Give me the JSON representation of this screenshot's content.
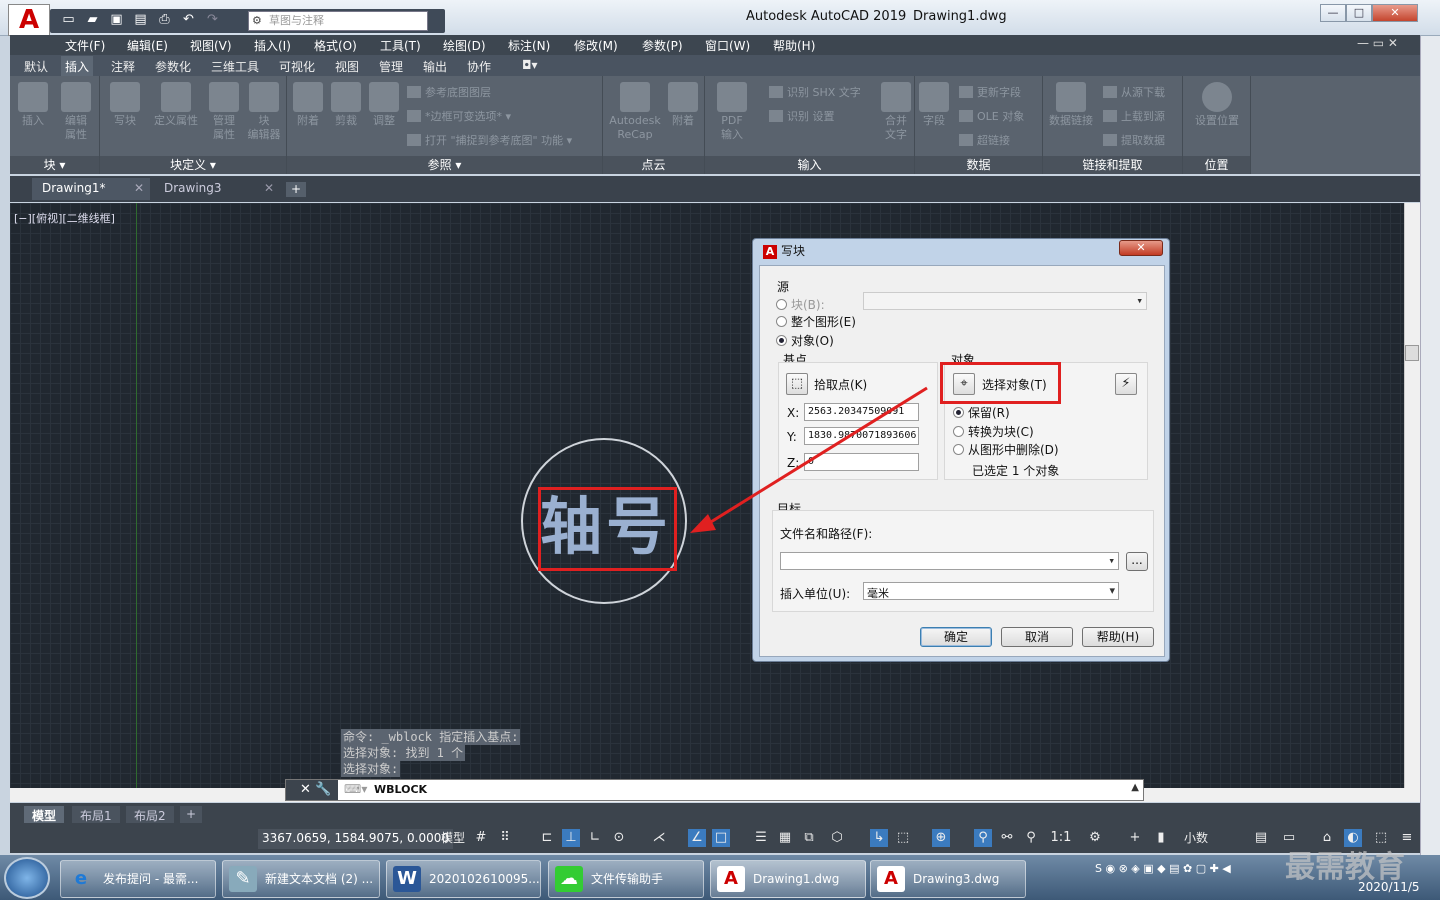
{
  "window": {
    "app_title": "Autodesk AutoCAD 2019",
    "doc_title": "Drawing1.dwg",
    "controls": [
      "—",
      "□",
      "✕"
    ]
  },
  "qat": {
    "workspace": "草图与注释"
  },
  "menubar": {
    "items": [
      "文件(F)",
      "编辑(E)",
      "视图(V)",
      "插入(I)",
      "格式(O)",
      "工具(T)",
      "绘图(D)",
      "标注(N)",
      "修改(M)",
      "参数(P)",
      "窗口(W)",
      "帮助(H)"
    ]
  },
  "ribbon_tabs": {
    "items": [
      "默认",
      "插入",
      "注释",
      "参数化",
      "三维工具",
      "可视化",
      "视图",
      "管理",
      "输出",
      "协作"
    ],
    "active": "插入"
  },
  "ribbon": {
    "panels": [
      "块 ▾",
      "块定义 ▾",
      "参照 ▾",
      "点云",
      "输入",
      "数据",
      "链接和提取",
      "位置"
    ],
    "block": [
      "插入",
      "编辑\n属性"
    ],
    "blockdef": [
      "写块",
      "定义属性",
      "管理\n属性",
      "块\n编辑器"
    ],
    "ref": [
      "附着",
      "剪裁",
      "调整"
    ],
    "ref_small": [
      "参考底图图层",
      "*边框可变选项*",
      "打开 \"捕捉到参考底图\" 功能"
    ],
    "pointcloud": [
      "Autodesk\nReCap",
      "附着"
    ],
    "import": [
      "PDF\n输入"
    ],
    "import_small": [
      "识别 SHX 文字",
      "识别 设置"
    ],
    "data": [
      "合并\n文字",
      "字段"
    ],
    "data_small": [
      "更新字段",
      "OLE 对象",
      "超链接"
    ],
    "link": [
      "数据链接"
    ],
    "link_small": [
      "从源下载",
      "上载到源",
      "提取数据"
    ],
    "location": [
      "设置位置"
    ]
  },
  "doc_tabs": {
    "items": [
      "Drawing1*",
      "Drawing3"
    ],
    "plus": "+"
  },
  "viewport": {
    "label": "[−][俯视][二维线框]"
  },
  "drawing": {
    "text": "轴号"
  },
  "command": {
    "history": [
      "命令: _wblock 指定插入基点:",
      "选择对象: 找到 1 个",
      "选择对象:"
    ],
    "input": "WBLOCK"
  },
  "layout_tabs": {
    "items": [
      "模型",
      "布局1",
      "布局2"
    ],
    "plus": "+"
  },
  "status": {
    "coords": "3367.0659, 1584.9075, 0.0000",
    "model": "模型",
    "scale": "1:1",
    "units": "小数"
  },
  "dialog": {
    "title": "写块",
    "source_label": "源",
    "radio_block": "块(B):",
    "radio_whole": "整个图形(E)",
    "radio_objects": "对象(O)",
    "basepoint_label": "基点",
    "pick_point": "拾取点(K)",
    "x_label": "X:",
    "x_value": "2563.20347509091",
    "y_label": "Y:",
    "y_value": "1830.9870071893606",
    "z_label": "Z:",
    "z_value": "0",
    "objects_label": "对象",
    "select_objects": "选择对象(T)",
    "retain": "保留(R)",
    "convert": "转换为块(C)",
    "delete": "从图形中删除(D)",
    "selected_count": "已选定 1 个对象",
    "target_label": "目标",
    "filename_label": "文件名和路径(F):",
    "filename_value": "",
    "browse": "...",
    "units_label": "插入单位(U):",
    "units_value": "毫米",
    "ok": "确定",
    "cancel": "取消",
    "help": "帮助(H)"
  },
  "taskbar": {
    "items": [
      "发布提问 - 最需...",
      "新建文本文档 (2) ...",
      "2020102610095...",
      "文件传输助手",
      "Drawing1.dwg",
      "Drawing3.dwg"
    ],
    "clock": "2020/11/5",
    "watermark": "最需教育"
  },
  "colors": {
    "accent_red": "#e02020",
    "canvas": "#212830"
  }
}
